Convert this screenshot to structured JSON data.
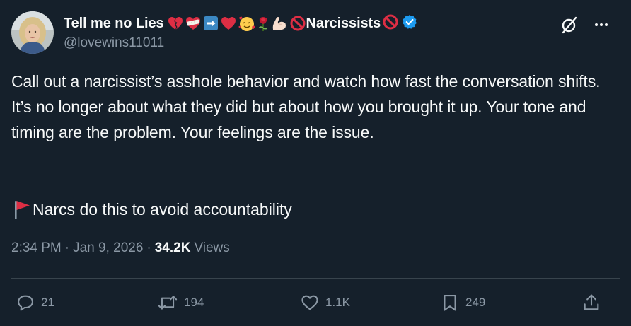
{
  "author": {
    "display_name": "Tell me no Lies",
    "name_suffix": "Narcissists",
    "handle": "@lovewins11011",
    "verified": true,
    "badge_color": "#1d9bf0",
    "name_icons": [
      "broken-heart-icon",
      "bandaged-heart-icon",
      "right-arrow-icon",
      "red-heart-icon",
      "smiling-face-with-hearts-icon",
      "rose-icon",
      "flexed-biceps-icon",
      "prohibited-icon"
    ],
    "name_trailing_icon": "prohibited-icon"
  },
  "top_actions": {
    "grok_icon": "grok-icon",
    "more_icon": "more-icon"
  },
  "post": {
    "text": "Call out a narcissist’s asshole behavior and watch how fast the conversation shifts. It’s no longer about what they did but about how you brought it up. Your tone and timing are the problem. Your feelings are the issue.",
    "flag_icon": "red-flag-icon",
    "flag_text": "Narcs do this to avoid accountability"
  },
  "meta": {
    "time": "2:34 PM",
    "separator": "·",
    "date": "Jan 9, 2026",
    "separator2": "·",
    "views_count": "34.2K",
    "views_label": "Views"
  },
  "actions": {
    "replies": "21",
    "reposts": "194",
    "likes": "1.1K",
    "bookmarks": "249"
  },
  "colors": {
    "background": "#15202b",
    "text": "#f7f9f9",
    "secondary_text": "#8b98a5",
    "divider": "#38444d"
  }
}
